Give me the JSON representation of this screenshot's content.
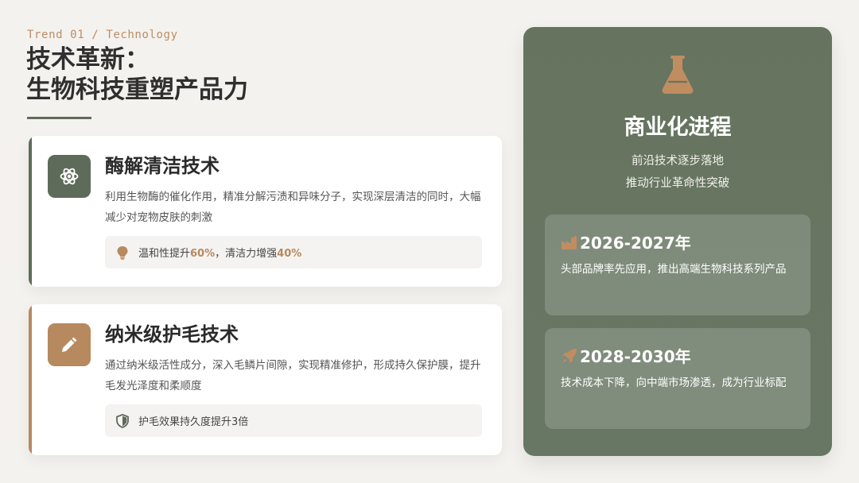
{
  "header": {
    "eyebrow": "Trend 01 / Technology",
    "title_line1": "技术革新：",
    "title_line2": "生物科技重塑产品力"
  },
  "cards": [
    {
      "icon": "atom-icon",
      "title": "酶解清洁技术",
      "description": "利用生物酶的催化作用，精准分解污渍和异味分子，实现深层清洁的同时，大幅减少对宠物皮肤的刺激",
      "note": {
        "icon": "lightbulb-icon",
        "part1": "温和性提升",
        "highlight1": "60%",
        "part2": "，清洁力增强",
        "highlight2": "40%"
      }
    },
    {
      "icon": "pen-icon",
      "title": "纳米级护毛技术",
      "description": "通过纳米级活性成分，深入毛鳞片间隙，实现精准修护，形成持久保护膜，提升毛发光泽度和柔顺度",
      "note": {
        "icon": "shield-icon",
        "text": "护毛效果持久度提升3倍"
      }
    }
  ],
  "panel": {
    "icon": "flask-icon",
    "title": "商业化进程",
    "subtitle_line1": "前沿技术逐步落地",
    "subtitle_line2": "推动行业革命性突破",
    "stages": [
      {
        "icon": "factory-icon",
        "year": "2026-2027年",
        "description": "头部品牌率先应用，推出高端生物科技系列产品"
      },
      {
        "icon": "rocket-icon",
        "year": "2028-2030年",
        "description": "技术成本下降，向中端市场渗透，成为行业标配"
      }
    ]
  },
  "colors": {
    "background": "#f4f2ee",
    "accent_green": "#5e6b5a",
    "accent_brown": "#b7895f",
    "panel": "#66745f"
  }
}
